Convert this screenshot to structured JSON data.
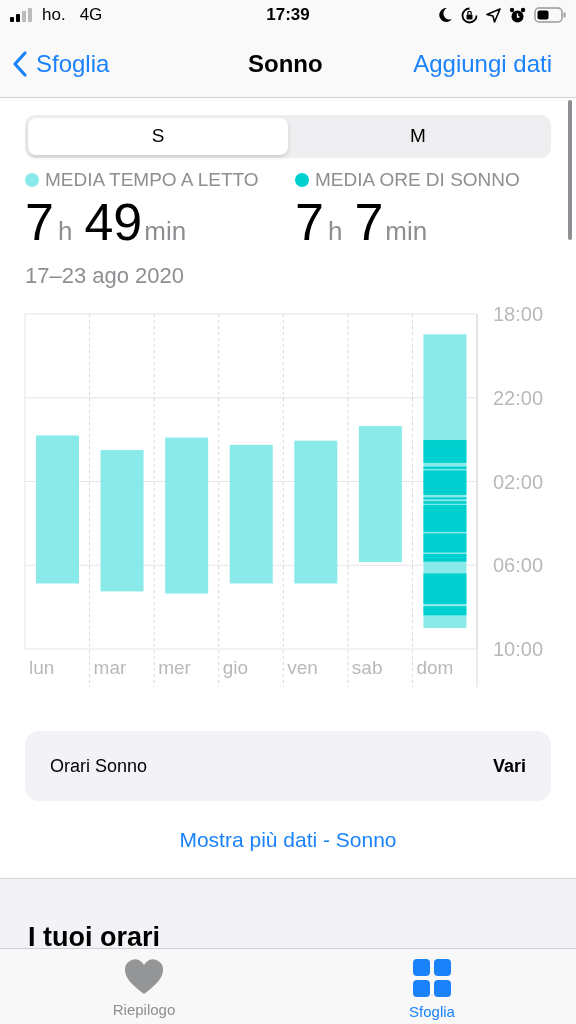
{
  "status_bar": {
    "carrier": "ho.",
    "network": "4G",
    "time": "17:39"
  },
  "nav": {
    "back": "Sfoglia",
    "title": "Sonno",
    "action": "Aggiungi dati"
  },
  "segments": [
    {
      "label": "S",
      "selected": true
    },
    {
      "label": "M",
      "selected": false
    }
  ],
  "stats": [
    {
      "label": "MEDIA TEMPO A LETTO",
      "color": "#8aeaea",
      "hours": "7",
      "hours_unit": "h",
      "minutes": "49",
      "minutes_unit": "min"
    },
    {
      "label": "MEDIA ORE DI SONNO",
      "color": "#00cfcf",
      "hours": "7",
      "hours_unit": "h",
      "minutes": "7",
      "minutes_unit": "min"
    }
  ],
  "date_range": "17–23 ago 2020",
  "sleep_chart": {
    "day_labels": [
      "lun",
      "mar",
      "mer",
      "gio",
      "ven",
      "sab",
      "dom"
    ],
    "time_labels": [
      "18:00",
      "22:00",
      "02:00",
      "06:00",
      "10:00"
    ]
  },
  "schedule_card": {
    "label": "Orari Sonno",
    "value": "Vari"
  },
  "more_link": "Mostra più dati - Sonno",
  "section_title": "I tuoi orari",
  "tab_bar": [
    {
      "label": "Riepilogo",
      "kind": "heart",
      "selected": false
    },
    {
      "label": "Sfoglia",
      "kind": "grid",
      "selected": true
    }
  ]
}
